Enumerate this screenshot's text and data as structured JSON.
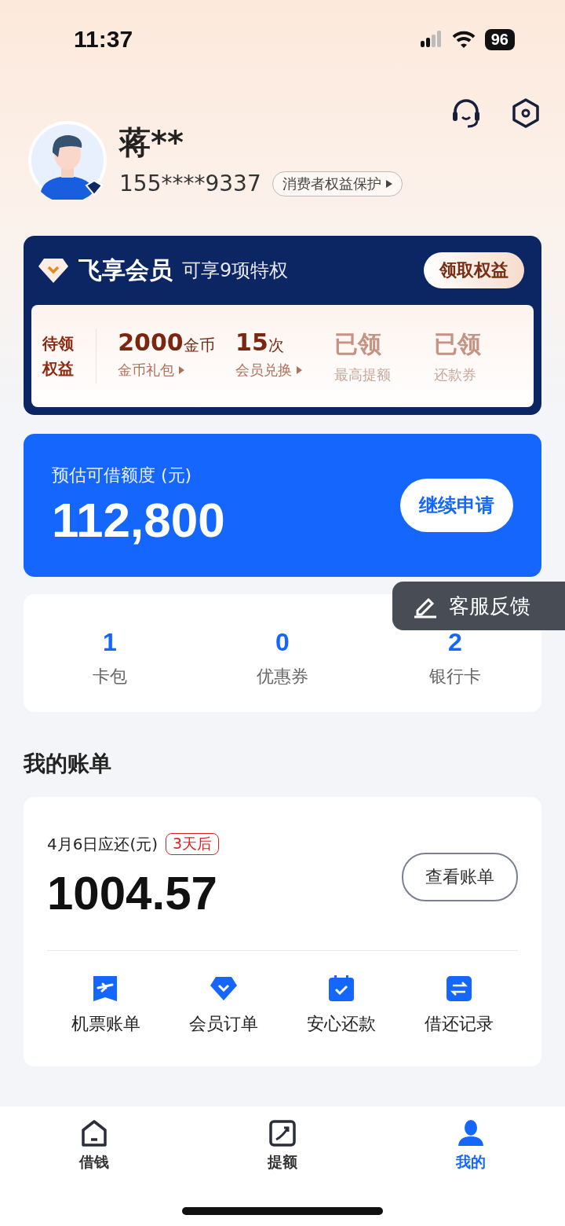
{
  "status_bar": {
    "time": "11:37",
    "battery": "96"
  },
  "profile": {
    "name": "蒋**",
    "phone": "155****9337",
    "rights_link": "消费者权益保护"
  },
  "membership": {
    "title": "飞享会员",
    "subtitle": "可享9项特权",
    "claim_button": "领取权益",
    "pending_label": "待领权益",
    "benefits": [
      {
        "value": "2000",
        "unit": "金币",
        "label": "金币礼包",
        "claimed": false
      },
      {
        "value": "15",
        "unit": "次",
        "label": "会员兑换",
        "claimed": false
      },
      {
        "value": "已领",
        "label": "最高提额",
        "claimed": true
      },
      {
        "value": "已领",
        "label": "还款券",
        "claimed": true
      }
    ]
  },
  "credit": {
    "label": "预估可借额度 (元)",
    "amount": "112,800",
    "button": "继续申请"
  },
  "stats": [
    {
      "value": "1",
      "label": "卡包"
    },
    {
      "value": "0",
      "label": "优惠券"
    },
    {
      "value": "2",
      "label": "银行卡"
    }
  ],
  "feedback_button": "客服反馈",
  "bills": {
    "heading": "我的账单",
    "due_label": "4月6日应还(元)",
    "due_badge": "3天后",
    "amount": "1004.57",
    "view_button": "查看账单",
    "shortcuts": [
      {
        "kind": "ticket",
        "label": "机票账单"
      },
      {
        "kind": "diamond",
        "label": "会员订单"
      },
      {
        "kind": "calendar",
        "label": "安心还款"
      },
      {
        "kind": "swap",
        "label": "借还记录"
      }
    ]
  },
  "tabs": [
    {
      "kind": "home",
      "label": "借钱",
      "selected": false
    },
    {
      "kind": "raise",
      "label": "提额",
      "selected": false
    },
    {
      "kind": "person",
      "label": "我的",
      "selected": true
    }
  ]
}
